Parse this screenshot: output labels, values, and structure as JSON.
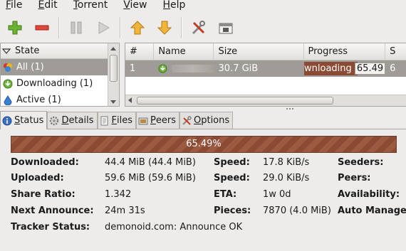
{
  "menu": {
    "items": [
      {
        "label": "File",
        "mnemonic": "F",
        "rest": "ile"
      },
      {
        "label": "Edit",
        "mnemonic": "E",
        "rest": "dit"
      },
      {
        "label": "Torrent",
        "mnemonic": "T",
        "rest": "orrent"
      },
      {
        "label": "View",
        "mnemonic": "V",
        "rest": "iew"
      },
      {
        "label": "Help",
        "mnemonic": "H",
        "rest": "elp"
      }
    ]
  },
  "toolbar": {
    "buttons": [
      "add-icon",
      "remove-icon",
      "pause-icon",
      "resume-icon",
      "queue-up-icon",
      "queue-down-icon",
      "preferences-icon",
      "connection-manager-icon"
    ]
  },
  "sidebar": {
    "header": "State",
    "items": [
      {
        "label": "All (1)",
        "icon": "all-icon",
        "selected": true
      },
      {
        "label": "Downloading (1)",
        "icon": "downloading-icon",
        "selected": false
      },
      {
        "label": "Active (1)",
        "icon": "active-icon",
        "selected": false
      }
    ]
  },
  "torrents": {
    "columns": [
      "#",
      "Name",
      "Size",
      "Progress",
      "S"
    ],
    "rows": [
      {
        "index": "1",
        "name": "",
        "size": "30.7 GiB",
        "state": "ownloading",
        "progress_text": "65.49",
        "progress": 0.6549,
        "extra": "6"
      }
    ]
  },
  "tabs": [
    {
      "label": "Status",
      "mnemonic": "S",
      "rest": "tatus",
      "icon": "info-icon",
      "active": true
    },
    {
      "label": "Details",
      "mnemonic": "D",
      "rest": "etails",
      "icon": "gear-icon",
      "active": false
    },
    {
      "label": "Files",
      "mnemonic": "F",
      "rest": "iles",
      "icon": "files-icon",
      "active": false
    },
    {
      "label": "Peers",
      "mnemonic": "P",
      "rest": "eers",
      "icon": "peers-icon",
      "active": false
    },
    {
      "label": "Options",
      "mnemonic": "O",
      "rest": "ptions",
      "icon": "options-icon",
      "active": false
    }
  ],
  "status": {
    "progress_text": "65.49%",
    "progress": 0.6549,
    "downloaded_label": "Downloaded:",
    "downloaded": "44.4 MiB (44.4 MiB)",
    "uploaded_label": "Uploaded:",
    "uploaded": "59.6 MiB (59.6 MiB)",
    "share_ratio_label": "Share Ratio:",
    "share_ratio": "1.342",
    "next_announce_label": "Next Announce:",
    "next_announce": "24m 31s",
    "tracker_status_label": "Tracker Status:",
    "tracker_status": "demonoid.com: Announce OK",
    "speed_down_label": "Speed:",
    "speed_down": "17.8 KiB/s",
    "speed_up_label": "Speed:",
    "speed_up": "29.0 KiB/s",
    "eta_label": "ETA:",
    "eta": "1w 0d",
    "pieces_label": "Pieces:",
    "pieces": "7870 (4.0 MiB)",
    "seeders_label": "Seeders:",
    "peers_label": "Peers:",
    "availability_label": "Availability:",
    "auto_managed_label": "Auto Managed:"
  },
  "colors": {
    "selection": "#9f9b96",
    "progress": "#8b4a33",
    "accent_green": "#5aa02c",
    "accent_red": "#d23a2a",
    "accent_orange": "#f0a020"
  }
}
